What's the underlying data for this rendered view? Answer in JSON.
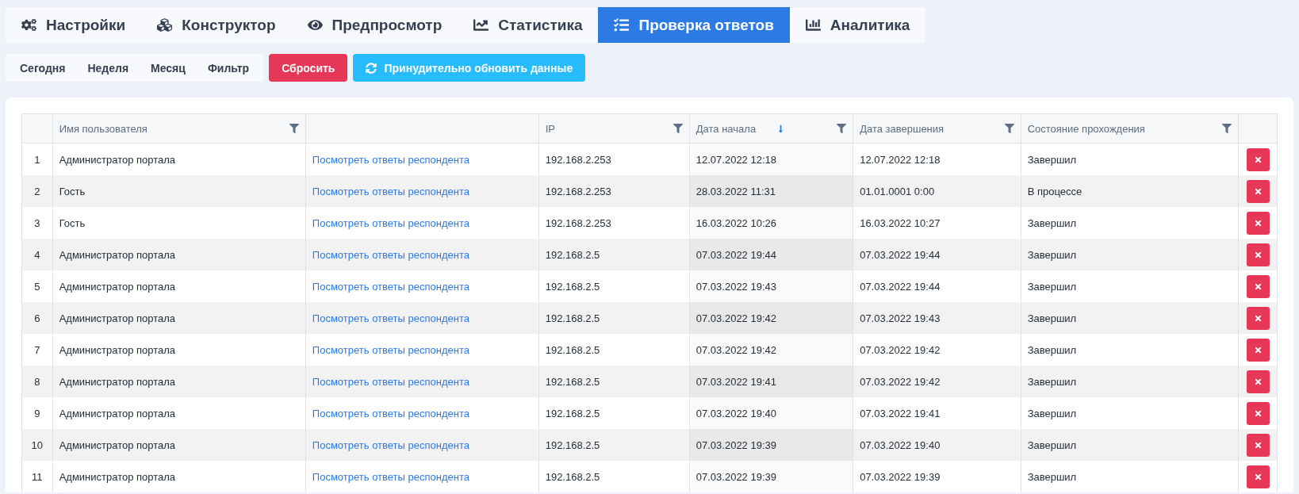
{
  "tabs": [
    {
      "label": "Настройки",
      "selected": false
    },
    {
      "label": "Конструктор",
      "selected": false
    },
    {
      "label": "Предпросмотр",
      "selected": false
    },
    {
      "label": "Статистика",
      "selected": false
    },
    {
      "label": "Проверка ответов",
      "selected": true
    },
    {
      "label": "Аналитика",
      "selected": false
    }
  ],
  "period_filters": [
    "Сегодня",
    "Неделя",
    "Месяц",
    "Фильтр"
  ],
  "reset_button": "Сбросить",
  "refresh_button": "Принудительно обновить данные",
  "table": {
    "columns": [
      {
        "kind": "index"
      },
      {
        "kind": "text",
        "label": "Имя пользователя",
        "filter": true
      },
      {
        "kind": "link"
      },
      {
        "kind": "text",
        "label": "IP",
        "filter": true
      },
      {
        "kind": "text",
        "label": "Дата начала",
        "filter": true,
        "sorted": true
      },
      {
        "kind": "text",
        "label": "Дата завершения",
        "filter": true
      },
      {
        "kind": "text",
        "label": "Состояние прохождения",
        "filter": true
      },
      {
        "kind": "action"
      }
    ],
    "rows": [
      {
        "index": "1",
        "user": "Администратор портала",
        "link": "Посмотреть ответы респондента",
        "ip": "192.168.2.253",
        "start": "12.07.2022 12:18",
        "end": "12.07.2022 12:18",
        "status": "Завершил"
      },
      {
        "index": "2",
        "user": "Гость",
        "link": "Посмотреть ответы респондента",
        "ip": "192.168.2.253",
        "start": "28.03.2022 11:31",
        "end": "01.01.0001 0:00",
        "status": "В процессе"
      },
      {
        "index": "3",
        "user": "Гость",
        "link": "Посмотреть ответы респондента",
        "ip": "192.168.2.253",
        "start": "16.03.2022 10:26",
        "end": "16.03.2022 10:27",
        "status": "Завершил"
      },
      {
        "index": "4",
        "user": "Администратор портала",
        "link": "Посмотреть ответы респондента",
        "ip": "192.168.2.5",
        "start": "07.03.2022 19:44",
        "end": "07.03.2022 19:44",
        "status": "Завершил"
      },
      {
        "index": "5",
        "user": "Администратор портала",
        "link": "Посмотреть ответы респондента",
        "ip": "192.168.2.5",
        "start": "07.03.2022 19:43",
        "end": "07.03.2022 19:44",
        "status": "Завершил"
      },
      {
        "index": "6",
        "user": "Администратор портала",
        "link": "Посмотреть ответы респондента",
        "ip": "192.168.2.5",
        "start": "07.03.2022 19:42",
        "end": "07.03.2022 19:43",
        "status": "Завершил"
      },
      {
        "index": "7",
        "user": "Администратор портала",
        "link": "Посмотреть ответы респондента",
        "ip": "192.168.2.5",
        "start": "07.03.2022 19:42",
        "end": "07.03.2022 19:42",
        "status": "Завершил"
      },
      {
        "index": "8",
        "user": "Администратор портала",
        "link": "Посмотреть ответы респондента",
        "ip": "192.168.2.5",
        "start": "07.03.2022 19:41",
        "end": "07.03.2022 19:42",
        "status": "Завершил"
      },
      {
        "index": "9",
        "user": "Администратор портала",
        "link": "Посмотреть ответы респондента",
        "ip": "192.168.2.5",
        "start": "07.03.2022 19:40",
        "end": "07.03.2022 19:41",
        "status": "Завершил"
      },
      {
        "index": "10",
        "user": "Администратор портала",
        "link": "Посмотреть ответы респондента",
        "ip": "192.168.2.5",
        "start": "07.03.2022 19:39",
        "end": "07.03.2022 19:40",
        "status": "Завершил"
      },
      {
        "index": "11",
        "user": "Администратор портала",
        "link": "Посмотреть ответы респондента",
        "ip": "192.168.2.5",
        "start": "07.03.2022 19:39",
        "end": "07.03.2022 19:39",
        "status": "Завершил"
      }
    ]
  }
}
